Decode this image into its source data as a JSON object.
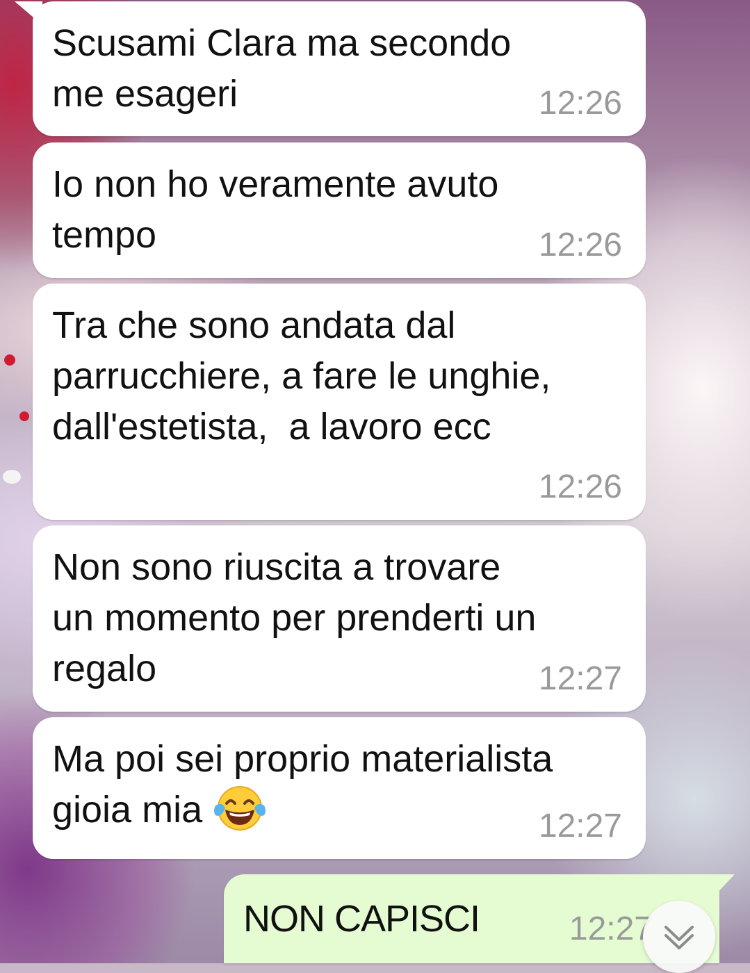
{
  "colors": {
    "incoming_bubble": "#ffffff",
    "outgoing_bubble": "#e5fbd2",
    "timestamp": "#9a9a9a",
    "text": "#111111"
  },
  "messages": [
    {
      "direction": "incoming",
      "text": "Scusami Clara ma secondo\nme esageri",
      "time": "12:26"
    },
    {
      "direction": "incoming",
      "text": "Io non ho veramente avuto\ntempo",
      "time": "12:26"
    },
    {
      "direction": "incoming",
      "text": "Tra che sono andata dal\nparrucchiere, a fare le unghie,\ndall'estetista,  a lavoro ecc",
      "time": "12:26"
    },
    {
      "direction": "incoming",
      "text": "Non sono riuscita a trovare\nun momento per prenderti un\nregalo",
      "time": "12:27"
    },
    {
      "direction": "incoming",
      "text": "Ma poi sei proprio materialista\ngioia mia ",
      "time": "12:27",
      "emoji": "face-with-tears-of-joy-icon"
    },
    {
      "direction": "outgoing",
      "text": "NON CAPISCI",
      "time": "12:27"
    }
  ],
  "scroll_button": {
    "icon": "double-chevron-down-icon"
  }
}
